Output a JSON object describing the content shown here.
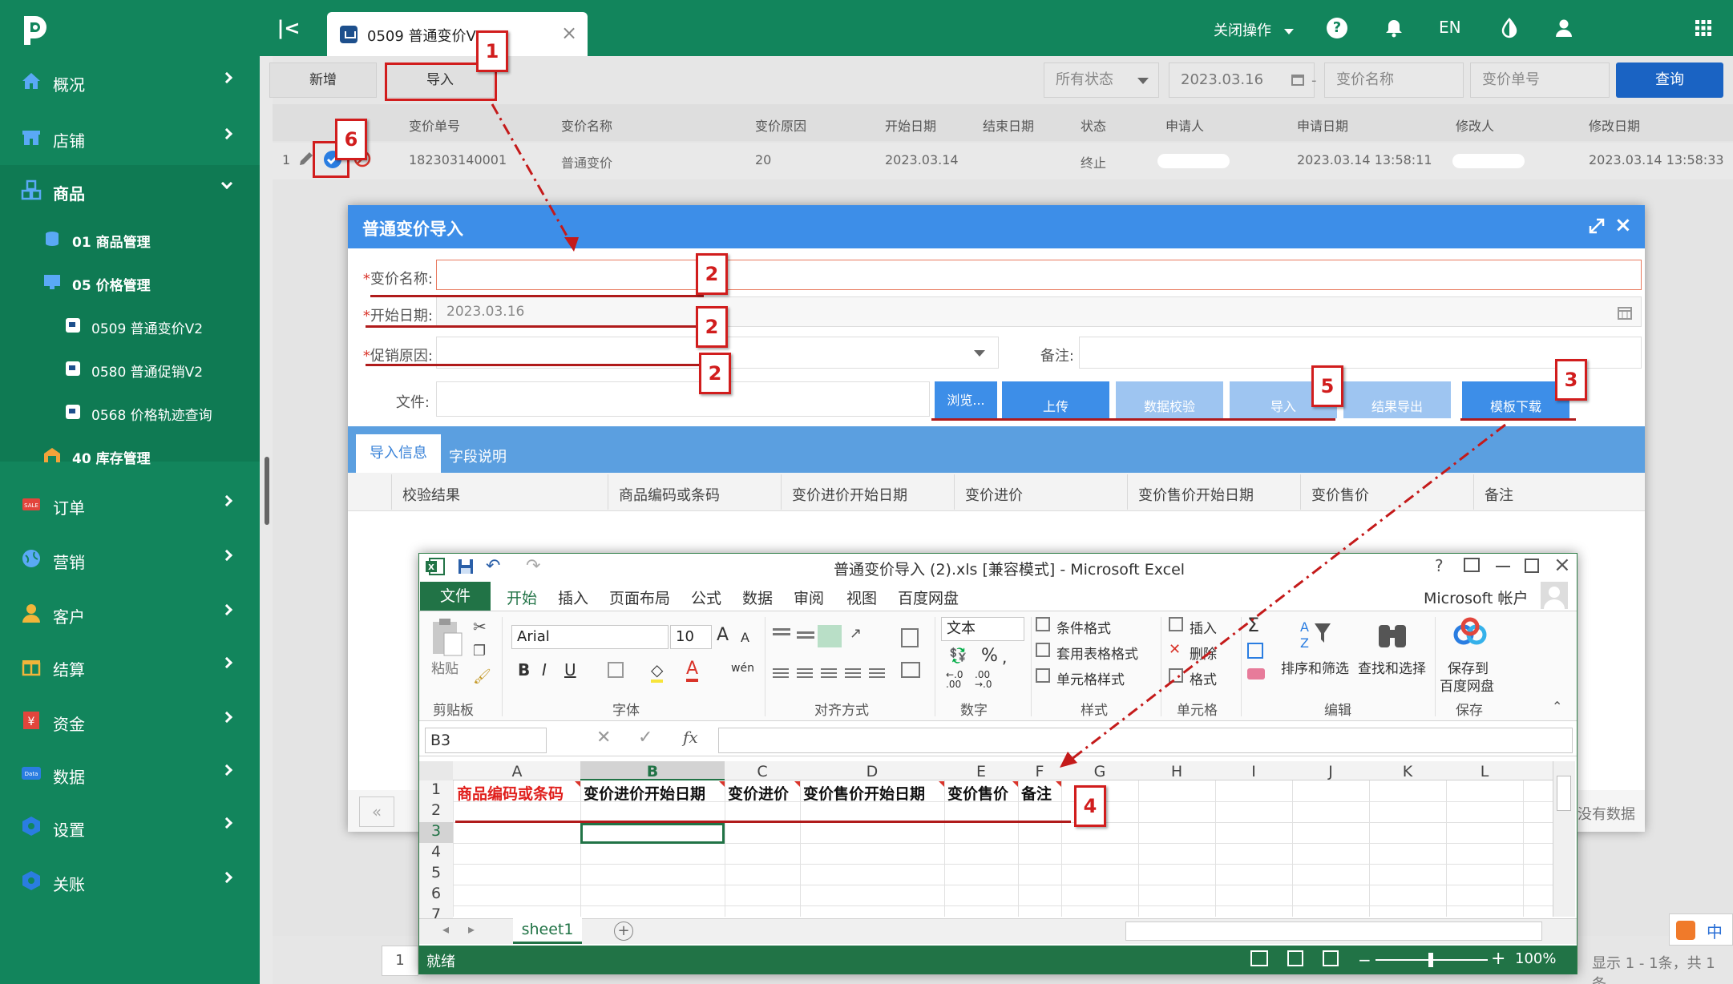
{
  "topbar": {
    "tab_label": "0509 普通变价V2",
    "tab_close": "×",
    "collapse": "|<",
    "close_ops": "关闭操作",
    "help": "?",
    "lang": "EN"
  },
  "sidebar": {
    "items": [
      {
        "label": "概况"
      },
      {
        "label": "店铺"
      },
      {
        "label": "商品"
      },
      {
        "label": "订单"
      },
      {
        "label": "营销"
      },
      {
        "label": "客户"
      },
      {
        "label": "结算"
      },
      {
        "label": "资金"
      },
      {
        "label": "数据"
      },
      {
        "label": "设置"
      },
      {
        "label": "关账"
      }
    ],
    "sub": [
      {
        "label": "01 商品管理"
      },
      {
        "label": "05 价格管理"
      },
      {
        "label": "40 库存管理"
      }
    ],
    "subsub": [
      {
        "label": "0509 普通变价V2"
      },
      {
        "label": "0580 普通促销V2"
      },
      {
        "label": "0568 价格轨迹查询"
      }
    ]
  },
  "toolbar": {
    "add": "新增",
    "import": "导入",
    "status_filter": "所有状态",
    "date_filter": "2023.03.16",
    "name_placeholder": "变价名称",
    "no_placeholder": "变价单号",
    "search": "查询"
  },
  "grid": {
    "headers": [
      "变价单号",
      "变价名称",
      "变价原因",
      "开始日期",
      "结束日期",
      "状态",
      "申请人",
      "申请日期",
      "修改人",
      "修改日期"
    ],
    "row": {
      "index": "1",
      "no": "182303140001",
      "name": "普通变价",
      "reason": "20",
      "start": "2023.03.14",
      "status": "终止",
      "apply_date": "2023.03.14 13:58:11",
      "modify_date": "2023.03.14 13:58:33"
    }
  },
  "modal": {
    "title": "普通变价导入",
    "name_label": "变价名称:",
    "start_label": "开始日期:",
    "start_value": "2023.03.16",
    "reason_label": "促销原因:",
    "remark_label": "备注:",
    "file_label": "文件:",
    "required_mark": "*",
    "buttons": [
      "浏览...",
      "上传",
      "数据校验",
      "导入",
      "结果导出",
      "模板下载"
    ],
    "tabs": [
      "导入信息",
      "字段说明"
    ],
    "columns": [
      "校验结果",
      "商品编码或条码",
      "变价进价开始日期",
      "变价进价",
      "变价售价开始日期",
      "变价售价",
      "备注"
    ],
    "no_data": "没有数据",
    "pager_first": "«"
  },
  "excel": {
    "title": "普通变价导入 (2).xls [兼容模式] - Microsoft Excel",
    "file_tab": "文件",
    "tabs": [
      "开始",
      "插入",
      "页面布局",
      "公式",
      "数据",
      "审阅",
      "视图",
      "百度网盘"
    ],
    "account": "Microsoft 帐户",
    "font_name": "Arial",
    "font_size": "10",
    "number_format": "文本",
    "ribbon": {
      "paste": "粘贴",
      "cond_format": "条件格式",
      "table_format": "套用表格格式",
      "cell_style": "单元格样式",
      "insert": "插入",
      "delete": "删除",
      "format": "格式",
      "sort_filter": "排序和筛选",
      "find_select": "查找和选择",
      "save_to": "保存到",
      "baidu": "百度网盘",
      "groups": [
        "剪贴板",
        "字体",
        "对齐方式",
        "数字",
        "样式",
        "单元格",
        "编辑",
        "保存"
      ]
    },
    "name_box": "B3",
    "fx": "fx",
    "col_letters": [
      "A",
      "B",
      "C",
      "D",
      "E",
      "F",
      "G",
      "H",
      "I",
      "J",
      "K",
      "L"
    ],
    "rows": [
      "1",
      "2",
      "3",
      "4",
      "5",
      "6",
      "7"
    ],
    "header_cells": [
      "商品编码或条码",
      "变价进价开始日期",
      "变价进价",
      "变价售价开始日期",
      "变价售价",
      "备注"
    ],
    "sheet": "sheet1",
    "status": "就绪",
    "zoom": "100%"
  },
  "annotations": [
    "1",
    "2",
    "2",
    "2",
    "3",
    "4",
    "5",
    "6"
  ],
  "footer": {
    "info": "显示 1 - 1条，共 1 条",
    "page": "1",
    "ime": "中"
  },
  "colors": {
    "brand_green": "#12855c",
    "modal_blue": "#3d8ee8",
    "excel_green": "#217346",
    "annotation_red": "#d11d1d"
  }
}
